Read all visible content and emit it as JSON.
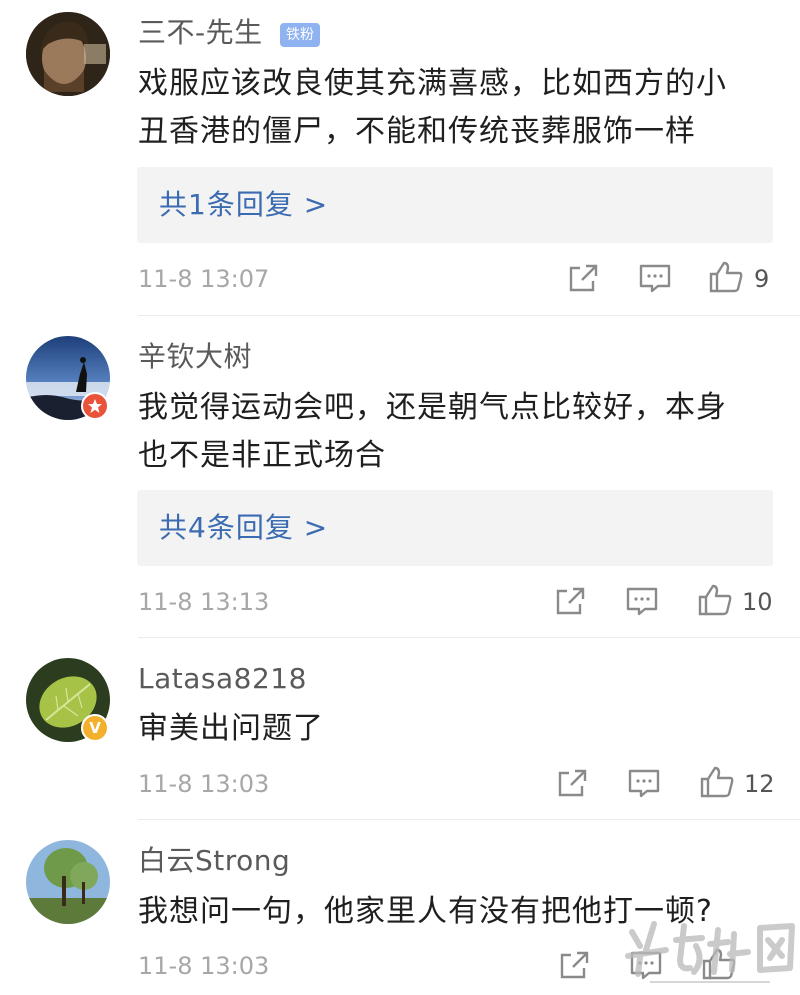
{
  "comments": [
    {
      "username": "三不-先生",
      "tag": "铁粉",
      "text_lines": [
        "戏服应该改良使其充满喜感，比如西方的小",
        "丑香港的僵尸，不能和传统丧葬服饰一样"
      ],
      "reply": "共1条回复 >",
      "time": "11-8 13:07",
      "likes": "9",
      "avatar_icon": "portrait-photo-icon"
    },
    {
      "username": "辛钦大树",
      "text_lines": [
        "我觉得运动会吧，还是朝气点比较好，本身",
        "也不是非正式场合"
      ],
      "reply": "共4条回复 >",
      "time": "11-8 13:13",
      "likes": "10",
      "badge_icon": "star-badge-icon",
      "badge_color": "#e8533a"
    },
    {
      "username": "Latasa8218",
      "text_lines": [
        "审美出问题了"
      ],
      "time": "11-8 13:03",
      "likes": "12",
      "badge_icon": "verified-v-icon",
      "badge_color": "#f3b02c"
    },
    {
      "username": "白云Strong",
      "text_lines": [
        "我想问一句，他家里人有没有把他打一顿?"
      ],
      "time": "11-8 13:03",
      "likes": ""
    }
  ],
  "colors": {
    "username": "#5a5a5a",
    "reply_link": "#3b6bb0",
    "time": "#a7a7a7",
    "reply_bg": "#f3f3f3",
    "tag_bg": "#8fb2f0"
  },
  "watermark": "watermark-logo"
}
